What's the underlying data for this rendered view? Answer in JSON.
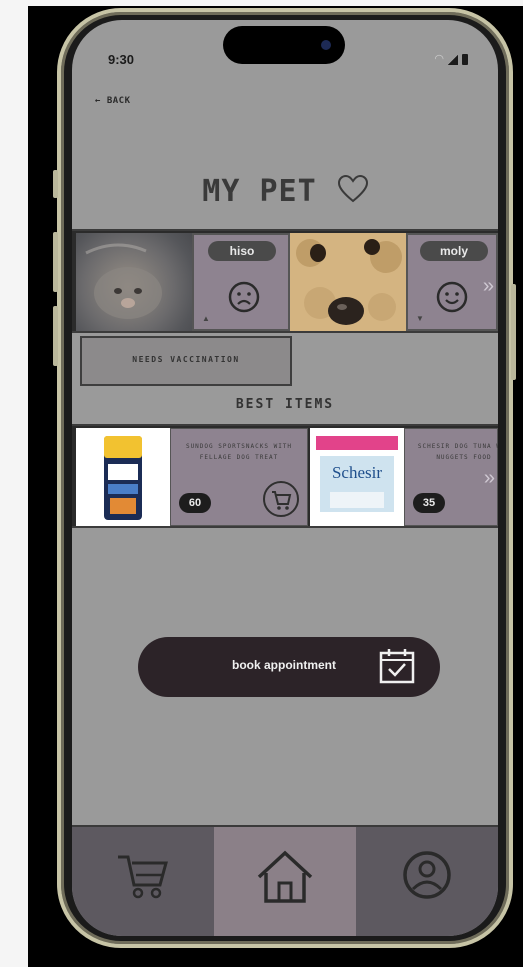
{
  "status": {
    "time": "9:30"
  },
  "header": {
    "back_label": "← BACK",
    "title": "MY  PET"
  },
  "pets": [
    {
      "name": "hiso",
      "mood": "sad"
    },
    {
      "name": "moly",
      "mood": "happy"
    }
  ],
  "vaccination": {
    "label": "NEEDS VACCINATION"
  },
  "best_items": {
    "heading": "BEST ITEMS",
    "items": [
      {
        "description": "SUNDOG SPORTSNACKS WITH FELLAGE DOG TREAT",
        "count": "60"
      },
      {
        "description": "SCHESIR DOG TUNA WET NUGGETS FOOD",
        "count": "35",
        "brand": "Schesir"
      }
    ]
  },
  "appointment": {
    "label": "book appointment"
  },
  "tabs": [
    {
      "icon": "cart-icon",
      "active": false
    },
    {
      "icon": "home-icon",
      "active": true
    },
    {
      "icon": "profile-icon",
      "active": false
    }
  ],
  "colors": {
    "screen_bg": "#9a9a9a",
    "card_bg": "#8e8390",
    "tab_active": "#8b8088",
    "tab_bar": "#5d5960",
    "button_dark": "#2c2328"
  }
}
